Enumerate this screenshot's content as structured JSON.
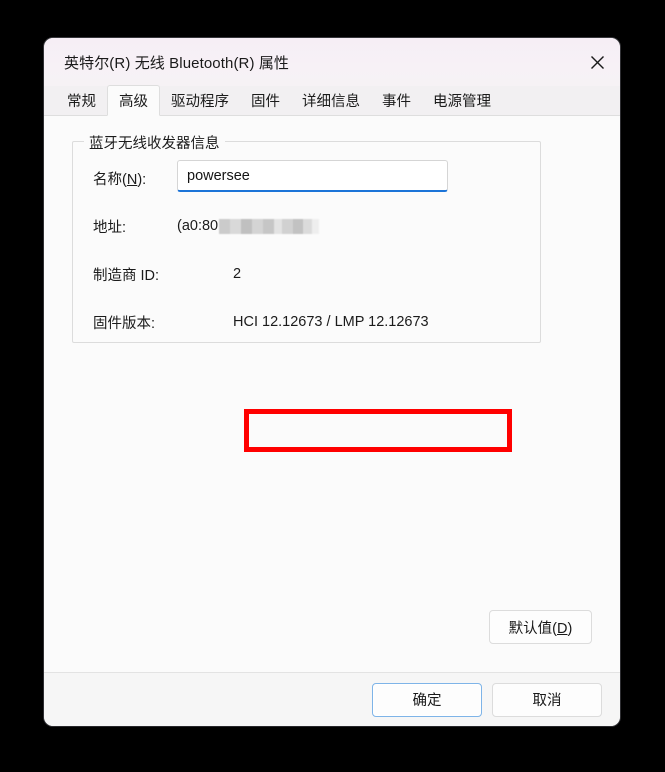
{
  "window": {
    "title": "英特尔(R) 无线 Bluetooth(R) 属性",
    "close_icon": "close-icon"
  },
  "tabs": [
    {
      "label": "常规",
      "selected": false
    },
    {
      "label": "高级",
      "selected": true
    },
    {
      "label": "驱动程序",
      "selected": false
    },
    {
      "label": "固件",
      "selected": false
    },
    {
      "label": "详细信息",
      "selected": false
    },
    {
      "label": "事件",
      "selected": false
    },
    {
      "label": "电源管理",
      "selected": false
    }
  ],
  "group": {
    "legend": "蓝牙无线收发器信息",
    "rows": {
      "name": {
        "label_prefix": "名称(",
        "label_accel": "N",
        "label_suffix": "):",
        "value": "powersee",
        "placeholder": ""
      },
      "address": {
        "label": "地址:",
        "value": "(a0:80",
        "redacted": true
      },
      "manufacturer": {
        "label": "制造商 ID:",
        "value": "2"
      },
      "firmware": {
        "label": "固件版本:",
        "value": "HCI 12.12673  /  LMP 12.12673",
        "highlighted": true
      }
    }
  },
  "annotation": {
    "color": "#ff0000",
    "target": "firmware-value"
  },
  "buttons": {
    "defaults_prefix": "默认值(",
    "defaults_accel": "D",
    "defaults_suffix": ")",
    "ok": "确定",
    "cancel": "取消"
  },
  "colors": {
    "accent": "#1b74d8",
    "annotation": "#ff0000",
    "titlebar": "#f7f1f6",
    "panel": "#fbfbfb"
  }
}
